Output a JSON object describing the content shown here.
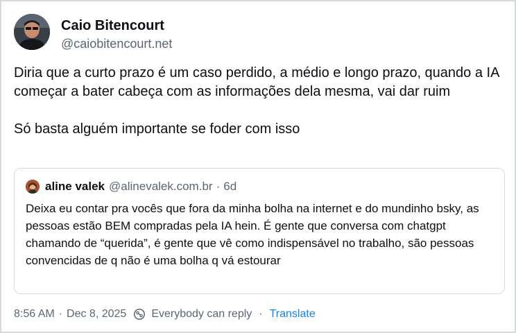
{
  "post": {
    "author": {
      "display_name": "Caio Bitencourt",
      "handle": "@caiobitencourt.net"
    },
    "paragraphs": [
      "Diria que a curto prazo é um caso perdido, a médio e longo prazo, quando a IA começar a bater cabeça com as informações dela mesma, vai dar ruim",
      "Só basta alguém importante se foder com isso"
    ]
  },
  "quote": {
    "author": {
      "display_name": "aline valek",
      "handle": "@alinevalek.com.br"
    },
    "separator": "·",
    "age": "6d",
    "text": "Deixa eu contar pra vocês que fora da minha bolha na internet e do mundinho bsky, as pessoas estão BEM compradas pela IA hein. É gente que conversa com chatgpt chamando de “querida”, é gente que vê como indispensável no trabalho, são pessoas convencidas de q não é uma bolha q vá estourar"
  },
  "footer": {
    "time": "8:56 AM",
    "separator": "·",
    "date": "Dec 8, 2025",
    "reply_setting_icon": "reply-settings-icon",
    "reply_setting": "Everybody can reply",
    "dot": "·",
    "translate": "Translate"
  },
  "colors": {
    "text": "#0b0f14",
    "muted": "#5b6675",
    "link": "#1083fe",
    "border": "#d6d9de"
  }
}
